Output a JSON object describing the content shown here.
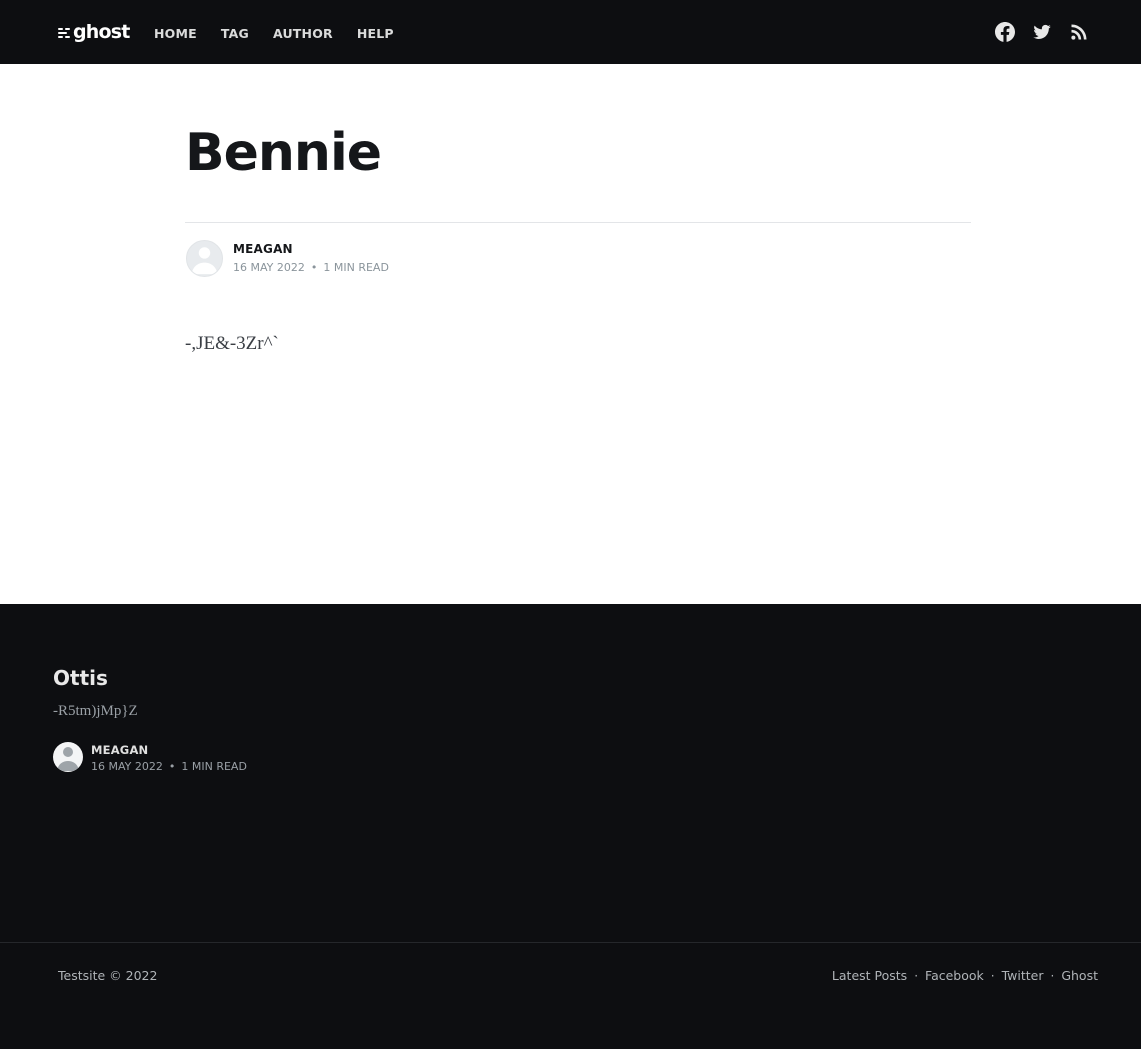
{
  "header": {
    "logo_text": "ghost",
    "nav": [
      {
        "label": "HOME"
      },
      {
        "label": "TAG"
      },
      {
        "label": "AUTHOR"
      },
      {
        "label": "HELP"
      }
    ],
    "social_icons": [
      "facebook-icon",
      "twitter-icon",
      "rss-icon"
    ]
  },
  "post": {
    "title": "Bennie",
    "author": "MEAGAN",
    "date": "16 MAY 2022",
    "separator": "•",
    "reading_time": "1 MIN READ",
    "content": "-,JE&-3Zr^`"
  },
  "related": {
    "title": "Ottis",
    "excerpt": "-R5tm)jMp}Z",
    "author": "MEAGAN",
    "date": "16 MAY 2022",
    "separator": "•",
    "reading_time": "1 MIN READ"
  },
  "footer": {
    "copyright": "Testsite © 2022",
    "links": [
      {
        "label": "Latest Posts"
      },
      {
        "label": "Facebook"
      },
      {
        "label": "Twitter"
      },
      {
        "label": "Ghost"
      }
    ],
    "link_separator": "·"
  },
  "colors": {
    "dark_bg": "#0d0e11",
    "content_bg": "#ffffff",
    "title_text": "#15171a",
    "meta_text": "#8a949b"
  }
}
